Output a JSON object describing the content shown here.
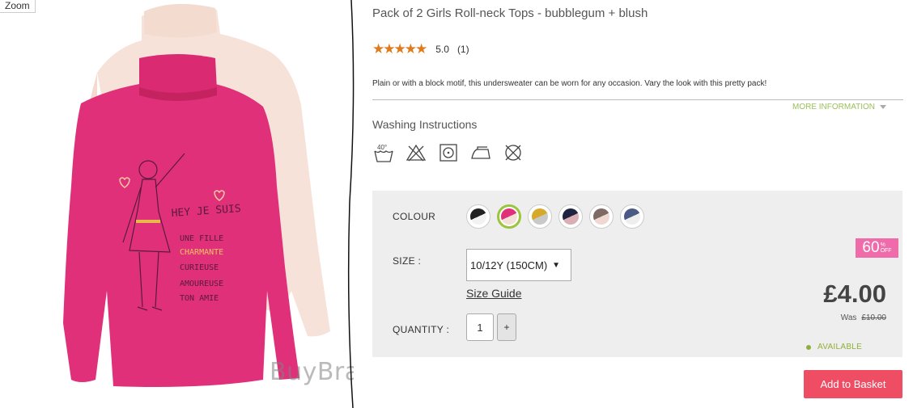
{
  "image": {
    "zoom_label": "Zoom",
    "watermark": "BuyBrands",
    "shirt_text": [
      "HEY JE SUIS",
      "UNE FILLE",
      "CHARMANTE",
      "CURIEUSE",
      "AMOUREUSE",
      "TON AMIE"
    ]
  },
  "product": {
    "title": "Pack of 2 Girls Roll-neck Tops - bubblegum + blush",
    "rating_value": "5.0",
    "rating_count": "(1)",
    "stars": 5,
    "description": "Plain or with a block motif, this undersweater can be worn for any occasion. Vary the look with this pretty pack!",
    "more_info": "MORE INFORMATION",
    "washing_title": "Washing Instructions",
    "washing_icons": [
      "wash-40-icon",
      "no-bleach-icon",
      "tumble-dry-icon",
      "iron-icon",
      "no-dry-clean-icon"
    ],
    "wash_temp": "40°"
  },
  "purchase": {
    "colour_label": "COLOUR",
    "colours": [
      {
        "name": "colour-black-white",
        "c1": "#222222",
        "c2": "#f2f2f2"
      },
      {
        "name": "colour-bubblegum-blush",
        "c1": "#e0307a",
        "c2": "#f3e1d8",
        "selected": true
      },
      {
        "name": "colour-mustard-grey",
        "c1": "#d6a92a",
        "c2": "#c9c9c9"
      },
      {
        "name": "colour-navy-pink",
        "c1": "#1e2340",
        "c2": "#d9aeb4"
      },
      {
        "name": "colour-taupe-blush",
        "c1": "#7e6a63",
        "c2": "#efd8d1"
      },
      {
        "name": "colour-denim-white",
        "c1": "#4a5a85",
        "c2": "#eeeeee"
      }
    ],
    "size_label": "SIZE :",
    "size_value": "10/12Y (150CM)",
    "size_guide": "Size Guide",
    "quantity_label": "QUANTITY :",
    "quantity_value": "1",
    "plus_label": "+",
    "discount_number": "60",
    "discount_pct": "%",
    "discount_off": "OFF",
    "price": "£4.00",
    "was_label": "Was",
    "was_price": "£10.00",
    "availability": "AVAILABLE",
    "add_to_basket": "Add to Basket"
  },
  "colors": {
    "accent_green": "#9bc53d",
    "button_red": "#ee4d64",
    "discount_pink": "#f06ba9",
    "star_orange": "#e07b1d"
  }
}
